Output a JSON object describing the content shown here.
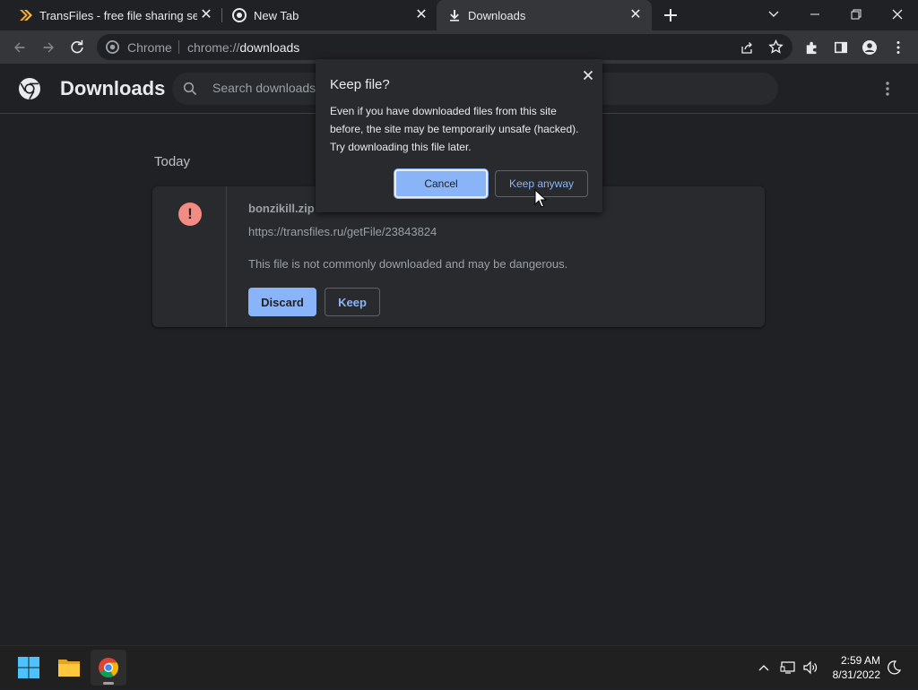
{
  "tabs": [
    {
      "title": "TransFiles - free file sharing servic",
      "favicon": "transfiles-icon"
    },
    {
      "title": "New Tab",
      "favicon": "chrome-icon"
    },
    {
      "title": "Downloads",
      "favicon": "download-icon",
      "active": true
    }
  ],
  "toolbar": {
    "chip": "Chrome",
    "url_scheme": "chrome://",
    "url_host": "downloads"
  },
  "header": {
    "title": "Downloads",
    "search_placeholder": "Search downloads"
  },
  "content": {
    "section": "Today",
    "item": {
      "filename": "bonzikill.zip",
      "url": "https://transfiles.ru/getFile/23843824",
      "warning": "This file is not commonly downloaded and may be dangerous.",
      "discard_label": "Discard",
      "keep_label": "Keep",
      "warning_icon_glyph": "!"
    }
  },
  "dialog": {
    "title": "Keep file?",
    "body": "Even if you have downloaded files from this site before, the site may be temporarily unsafe (hacked). Try downloading this file later.",
    "cancel_label": "Cancel",
    "keep_anyway_label": "Keep anyway"
  },
  "taskbar": {
    "time": "2:59 AM",
    "date": "8/31/2022"
  },
  "colors": {
    "accent": "#8ab4f8",
    "warning": "#f28b82",
    "background": "#202124",
    "toolbar": "#35363a"
  }
}
